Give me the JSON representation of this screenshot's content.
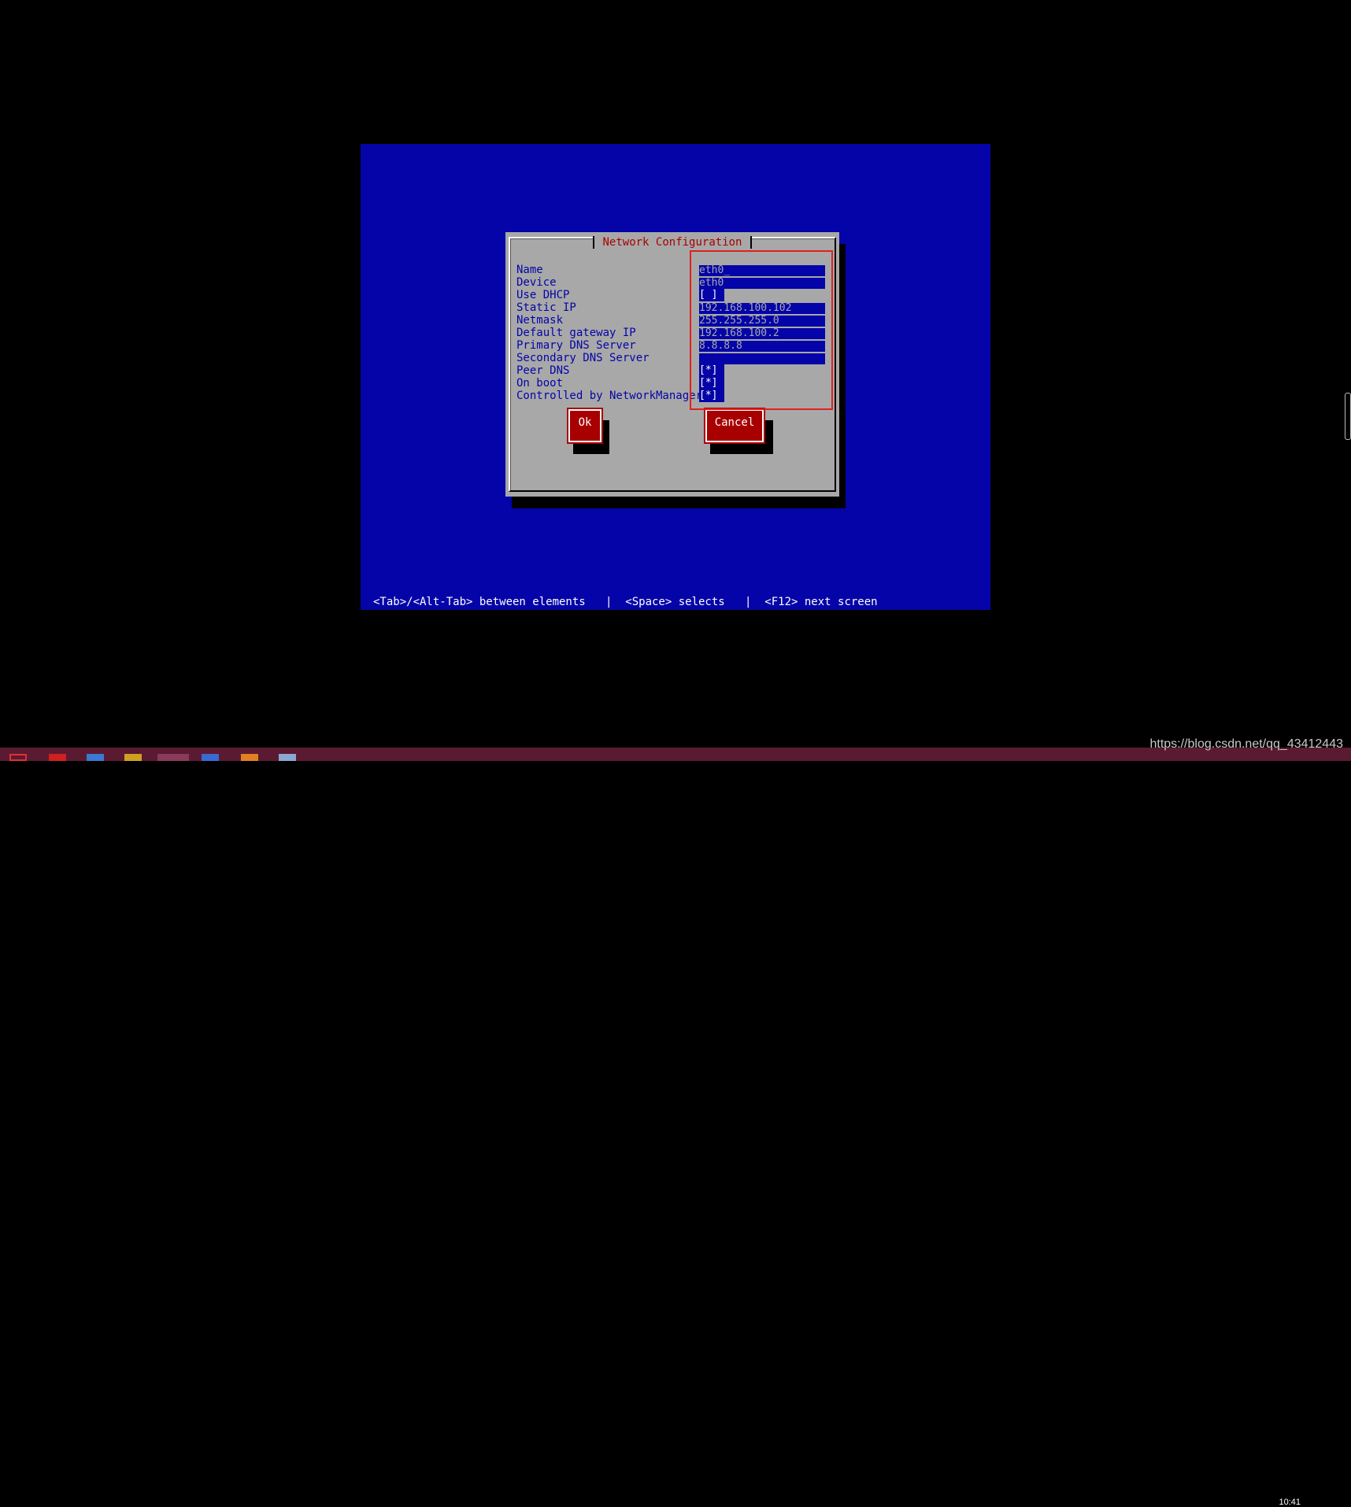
{
  "dialog": {
    "title": "Network Configuration",
    "fields": [
      {
        "label": "Name",
        "value": "eth0_"
      },
      {
        "label": "Device",
        "value": "eth0"
      },
      {
        "label": "Use DHCP",
        "value": "[ ]"
      },
      {
        "label": "Static IP",
        "value": "192.168.100.102"
      },
      {
        "label": "Netmask",
        "value": "255.255.255.0"
      },
      {
        "label": "Default gateway IP",
        "value": "192.168.100.2"
      },
      {
        "label": "Primary DNS Server",
        "value": "8.8.8.8"
      },
      {
        "label": "Secondary DNS Server",
        "value": ""
      },
      {
        "label": "Peer DNS",
        "value": "[*]"
      },
      {
        "label": "On boot",
        "value": "[*]"
      },
      {
        "label": "Controlled by NetworkManager",
        "value": "[*]"
      }
    ],
    "ok_label": "Ok",
    "cancel_label": "Cancel"
  },
  "help_bar": "<Tab>/<Alt-Tab> between elements   |  <Space> selects   |  <F12> next screen",
  "watermark": "https://blog.csdn.net/qq_43412443",
  "clock": "10:41",
  "colors": {
    "screen_bg": "#0404a8",
    "dialog_bg": "#a8a8a8",
    "title": "#a80000",
    "button": "#a80000",
    "highlight": "#e02020",
    "taskbar": "#5a1a32"
  }
}
